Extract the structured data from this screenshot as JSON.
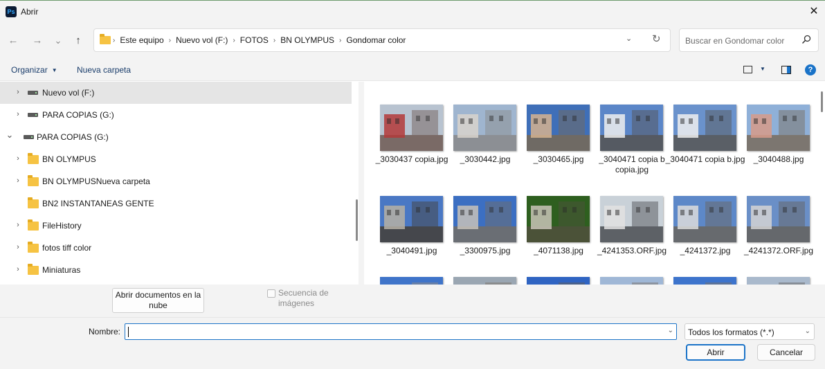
{
  "window": {
    "app_icon": "Ps",
    "title": "Abrir",
    "close": "✕"
  },
  "nav": {
    "back_icon": "←",
    "forward_icon": "→",
    "recent_icon": "⌄",
    "up_icon": "↑",
    "breadcrumbs": [
      "Este equipo",
      "Nuevo vol  (F:)",
      "FOTOS",
      "BN OLYMPUS",
      "Gondomar color"
    ],
    "search_placeholder": "Buscar en Gondomar color"
  },
  "toolbar": {
    "organize": "Organizar",
    "new_folder": "Nueva carpeta",
    "help": "?"
  },
  "tree": [
    {
      "label": "Nuevo vol  (F:)",
      "icon": "drive-icon",
      "expanded": false,
      "selected": true,
      "indent": 1
    },
    {
      "label": "PARA COPIAS (G:)",
      "icon": "drive-icon",
      "expanded": false,
      "selected": false,
      "indent": 1
    },
    {
      "label": "PARA COPIAS (G:)",
      "icon": "drive-icon",
      "expanded": true,
      "selected": false,
      "indent": 0
    },
    {
      "label": "BN OLYMPUS",
      "icon": "folder-icon",
      "expanded": false,
      "selected": false,
      "indent": 1
    },
    {
      "label": "BN OLYMPUSNueva carpeta",
      "icon": "folder-icon",
      "expanded": false,
      "selected": false,
      "indent": 1
    },
    {
      "label": "BN2 INSTANTANEAS GENTE",
      "icon": "folder-icon",
      "expanded": null,
      "selected": false,
      "indent": 1
    },
    {
      "label": "FileHistory",
      "icon": "folder-icon",
      "expanded": false,
      "selected": false,
      "indent": 1
    },
    {
      "label": "fotos tiff color",
      "icon": "folder-icon",
      "expanded": false,
      "selected": false,
      "indent": 1
    },
    {
      "label": "Miniaturas",
      "icon": "folder-icon",
      "expanded": false,
      "selected": false,
      "indent": 1
    }
  ],
  "files": [
    {
      "name": "_3030437 copia.jpg",
      "sky": "#b8c3d0",
      "ground": "#7a6a66",
      "accent": "#b33a3a"
    },
    {
      "name": "_3030442.jpg",
      "sky": "#9fb5cf",
      "ground": "#8c8f94",
      "accent": "#d8d4cc"
    },
    {
      "name": "_3030465.jpg",
      "sky": "#3f6fb8",
      "ground": "#6f6a64",
      "accent": "#d6b38f"
    },
    {
      "name": "_3040471 copia b copia.jpg",
      "sky": "#5b86c8",
      "ground": "#555a62",
      "accent": "#efefef"
    },
    {
      "name": "_3040471 copia b.jpg",
      "sky": "#6a92cc",
      "ground": "#5a5f66",
      "accent": "#efefef"
    },
    {
      "name": "_3040488.jpg",
      "sky": "#8fb0d8",
      "ground": "#7c7670",
      "accent": "#d79b8a"
    },
    {
      "name": "_3040491.jpg",
      "sky": "#4a78c4",
      "ground": "#45474c",
      "accent": "#b6b0a4"
    },
    {
      "name": "_3300975.jpg",
      "sky": "#3c6fc2",
      "ground": "#6a6e74",
      "accent": "#c7c2ba"
    },
    {
      "name": "_4071138.jpg",
      "sky": "#2e5f1f",
      "ground": "#4b5238",
      "accent": "#c9c4b8"
    },
    {
      "name": "_4241353.ORF.jpg",
      "sky": "#c9d1d8",
      "ground": "#5d6166",
      "accent": "#e2e2e2"
    },
    {
      "name": "_4241372.jpg",
      "sky": "#5d88c8",
      "ground": "#676a6e",
      "accent": "#dcdcdc"
    },
    {
      "name": "_4241372.ORF.jpg",
      "sky": "#6a8fc7",
      "ground": "#65686c",
      "accent": "#d4d4d4"
    },
    {
      "name": "",
      "sky": "#3f74c9",
      "ground": "#8a8a8a",
      "accent": "#ffffff"
    },
    {
      "name": "",
      "sky": "#9aa6b2",
      "ground": "#7d7670",
      "accent": "#c9c2b8"
    },
    {
      "name": "",
      "sky": "#2f64c2",
      "ground": "#5e5e5e",
      "accent": "#d0d0d0"
    },
    {
      "name": "",
      "sky": "#9fb7d6",
      "ground": "#7b7874",
      "accent": "#c8c4be"
    },
    {
      "name": "",
      "sky": "#3d74cc",
      "ground": "#76726e",
      "accent": "#b33a3a"
    },
    {
      "name": "",
      "sky": "#a9b9cc",
      "ground": "#6c6c6c",
      "accent": "#cfcfcf"
    }
  ],
  "options": {
    "cloud_button": "Abrir documentos en la nube",
    "sequence_label": "Secuencia de imágenes",
    "sequence_checked": false
  },
  "footer": {
    "name_label": "Nombre:",
    "name_value": "",
    "filetype_value": "Todos los formatos (*.*)",
    "open_button": "Abrir",
    "cancel_button": "Cancelar"
  },
  "colors": {
    "accent": "#1a73c8",
    "folder": "#f6c343",
    "chrome": "#f3f3f3"
  }
}
